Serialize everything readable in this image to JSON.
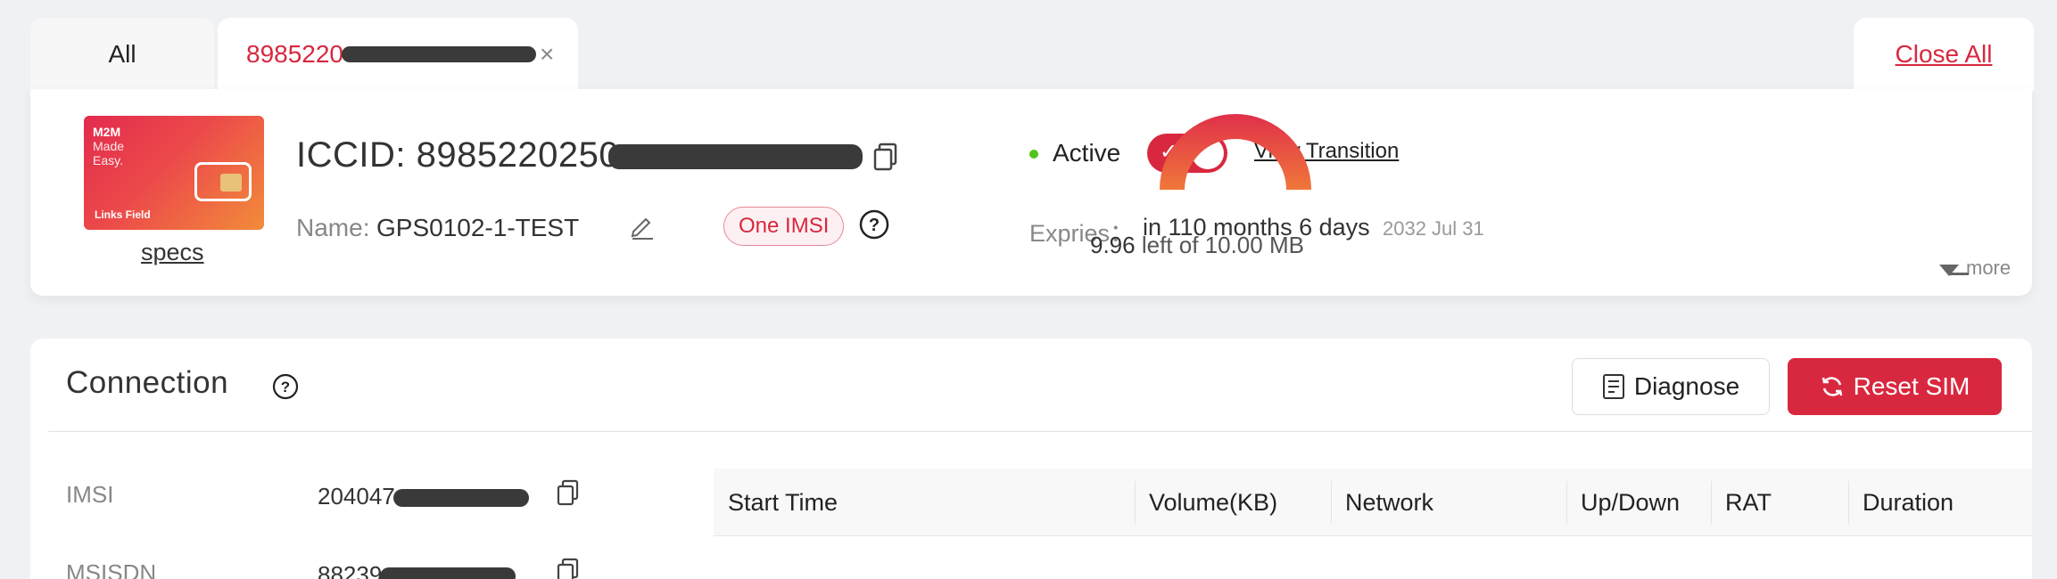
{
  "tabs": {
    "all_label": "All",
    "sim_label": "8985220",
    "sim_label_tail": "",
    "close_all_label": "Close All"
  },
  "sim_card": {
    "line1": "M2M",
    "line2": "Made Easy.",
    "brand": "Links Field",
    "specs_label": "specs"
  },
  "summary": {
    "iccid_label": "ICCID:",
    "iccid_visible": "8985220250",
    "name_label": "Name:",
    "name_value": "GPS0102-1-TEST",
    "badge_label": "One IMSI",
    "status_label": "Active",
    "status_color": "#52c41a",
    "toggle_on": true,
    "view_transition_label": "View Transition",
    "expires_label": "Expries：",
    "expires_value": "in 110 months 6 days",
    "expires_date": "2032 Jul 31",
    "data_left_value": "9.96",
    "data_left_text": "left of 10.00 MB",
    "data_used_fraction": 0.996,
    "more_label": "more"
  },
  "connection": {
    "title": "Connection",
    "diagnose_label": "Diagnose",
    "reset_label": "Reset SIM",
    "imsi_label": "IMSI",
    "imsi_value": "204047",
    "msisdn_label": "MSISDN",
    "msisdn_value": "88239",
    "table_headers": [
      "Start Time",
      "Volume(KB)",
      "Network",
      "Up/Down",
      "RAT",
      "Duration"
    ]
  },
  "colors": {
    "accent": "#d8283f",
    "gauge_start": "#f0773a",
    "gauge_end": "#e0304a"
  },
  "icons": [
    "copy-icon",
    "edit-icon",
    "help-icon",
    "close-icon",
    "diagnose-icon",
    "refresh-icon",
    "caret-down-icon"
  ]
}
